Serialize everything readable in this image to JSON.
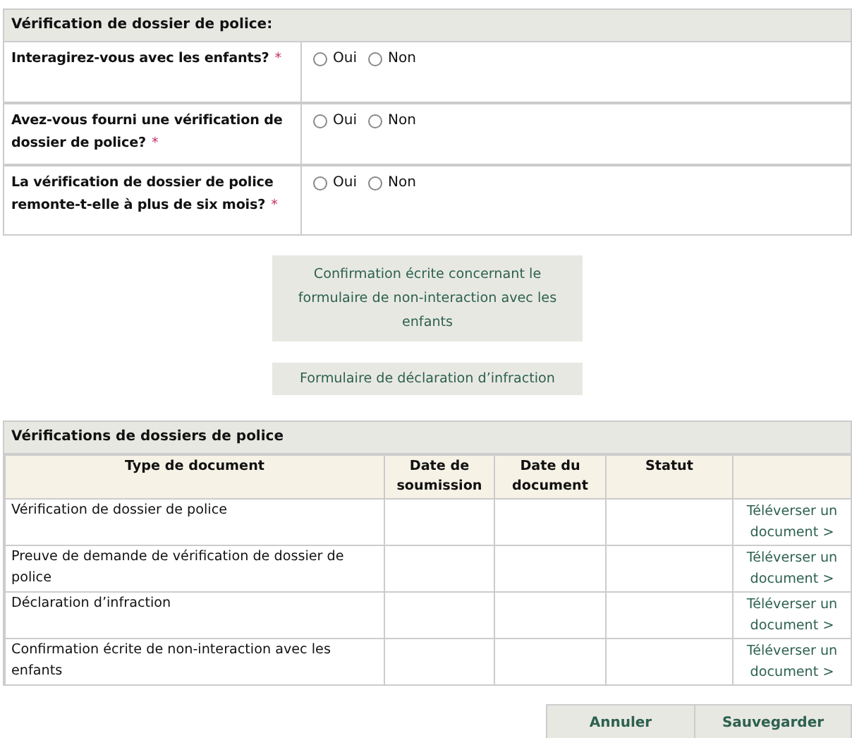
{
  "police_check": {
    "title": "Vérification de dossier de police:",
    "questions": [
      {
        "label": "Interagirez-vous avec les enfants?",
        "required_mark": "*",
        "options": [
          {
            "label": "Oui",
            "selected": false
          },
          {
            "label": "Non",
            "selected": false
          }
        ]
      },
      {
        "label": "Avez-vous fourni une vérification de dossier de police?",
        "required_mark": "*",
        "options": [
          {
            "label": "Oui",
            "selected": false
          },
          {
            "label": "Non",
            "selected": false
          }
        ]
      },
      {
        "label": "La vérification de dossier de police remonte-t-elle à plus de six mois?",
        "required_mark": "*",
        "options": [
          {
            "label": "Oui",
            "selected": false
          },
          {
            "label": "Non",
            "selected": false
          }
        ]
      }
    ]
  },
  "form_buttons": [
    "Confirmation écrite concernant le formulaire de non-interaction avec les enfants",
    "Formulaire de déclaration d’infraction"
  ],
  "documents": {
    "title": "Vérifications de dossiers de police",
    "columns": [
      "Type de document",
      "Date de soumission",
      "Date du document",
      "Statut"
    ],
    "rows": [
      {
        "type": "Vérification de dossier de police",
        "action": "Téléverser un document >"
      },
      {
        "type": "Preuve de demande de vérification de dossier de police",
        "action": "Téléverser un document >"
      },
      {
        "type": "Déclaration d’infraction",
        "action": "Téléverser un document >"
      },
      {
        "type": "Confirmation écrite de non-interaction avec les enfants",
        "action": "Téléverser un document >"
      }
    ]
  },
  "buttons": [
    "Annuler",
    "Sauvegarder"
  ]
}
